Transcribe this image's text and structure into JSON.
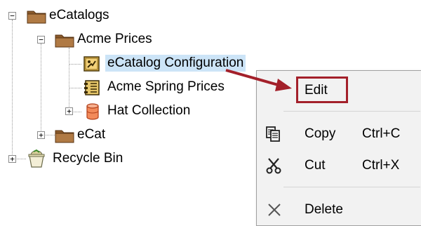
{
  "tree": {
    "nodes": [
      {
        "label": "eCatalogs",
        "expander": "−"
      },
      {
        "label": "Acme Prices",
        "expander": "−"
      },
      {
        "label": "eCatalog Configuration"
      },
      {
        "label": "Acme Spring Prices"
      },
      {
        "label": "Hat Collection",
        "expander": "+"
      },
      {
        "label": "eCat",
        "expander": "+"
      },
      {
        "label": "Recycle Bin",
        "expander": "+"
      }
    ],
    "selected": "eCatalog Configuration"
  },
  "context_menu": {
    "items": [
      {
        "label": "Edit",
        "shortcut": "",
        "icon": null
      },
      {
        "label": "Copy",
        "shortcut": "Ctrl+C",
        "icon": "copy-icon"
      },
      {
        "label": "Cut",
        "shortcut": "Ctrl+X",
        "icon": "cut-icon"
      },
      {
        "label": "Delete",
        "shortcut": "",
        "icon": "delete-icon"
      }
    ]
  },
  "colors": {
    "selection": "#cce4f7",
    "callout": "#a3202a",
    "folder": "#a0643a"
  }
}
